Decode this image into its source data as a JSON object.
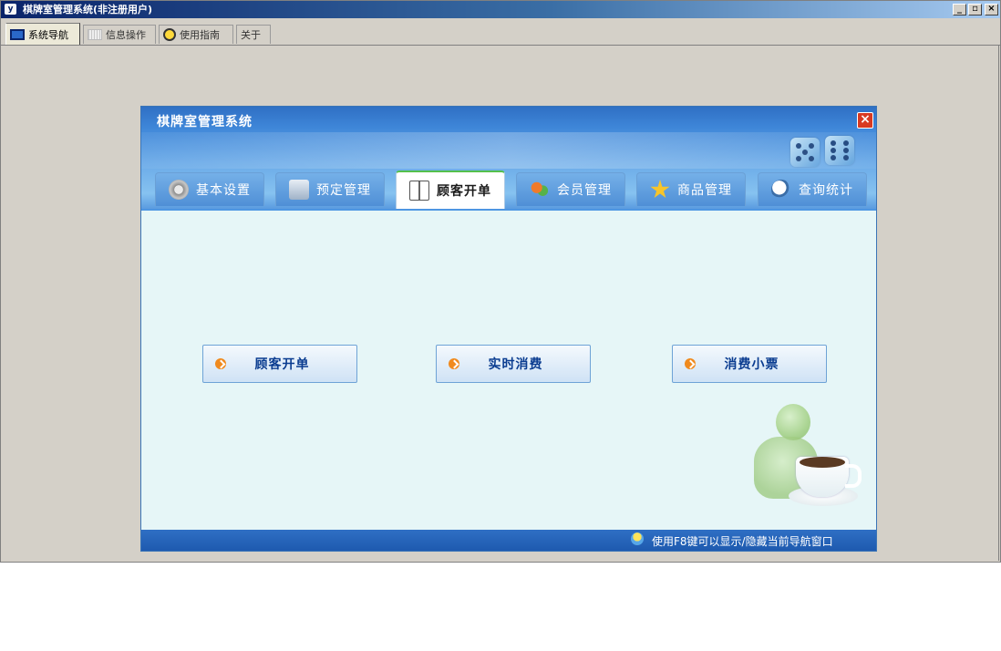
{
  "window": {
    "title": "棋牌室管理系统(非注册用户)",
    "controls": {
      "minimize": "_",
      "restore": "▫",
      "close": "×"
    }
  },
  "mdi_tabs": [
    {
      "label": "系统导航",
      "icon": "monitor-icon",
      "active": true
    },
    {
      "label": "信息操作",
      "icon": "grid-icon",
      "active": false
    },
    {
      "label": "使用指南",
      "icon": "compass-icon",
      "active": false
    },
    {
      "label": "关于",
      "icon": null,
      "active": false
    }
  ],
  "panel": {
    "title": "棋牌室管理系统",
    "close": "×",
    "tabs": [
      {
        "label": "基本设置",
        "icon": "gear-icon",
        "active": false
      },
      {
        "label": "预定管理",
        "icon": "monitor-icon",
        "active": false
      },
      {
        "label": "顾客开单",
        "icon": "book-icon",
        "active": true
      },
      {
        "label": "会员管理",
        "icon": "people-icon",
        "active": false
      },
      {
        "label": "商品管理",
        "icon": "star-icon",
        "active": false
      },
      {
        "label": "查询统计",
        "icon": "magnifier-icon",
        "active": false
      }
    ],
    "actions": [
      {
        "label": "顾客开单",
        "icon": "orange-arrow-icon"
      },
      {
        "label": "实时消费",
        "icon": "orange-arrow-icon"
      },
      {
        "label": "消费小票",
        "icon": "orange-arrow-icon"
      }
    ],
    "status": "使用F8键可以显示/隐藏当前导航窗口"
  },
  "colors": {
    "panel_header": "#3e86d8",
    "active_tab_accent": "#54c04c",
    "button_text": "#0a3c90",
    "arrow": "#f08a1e"
  }
}
